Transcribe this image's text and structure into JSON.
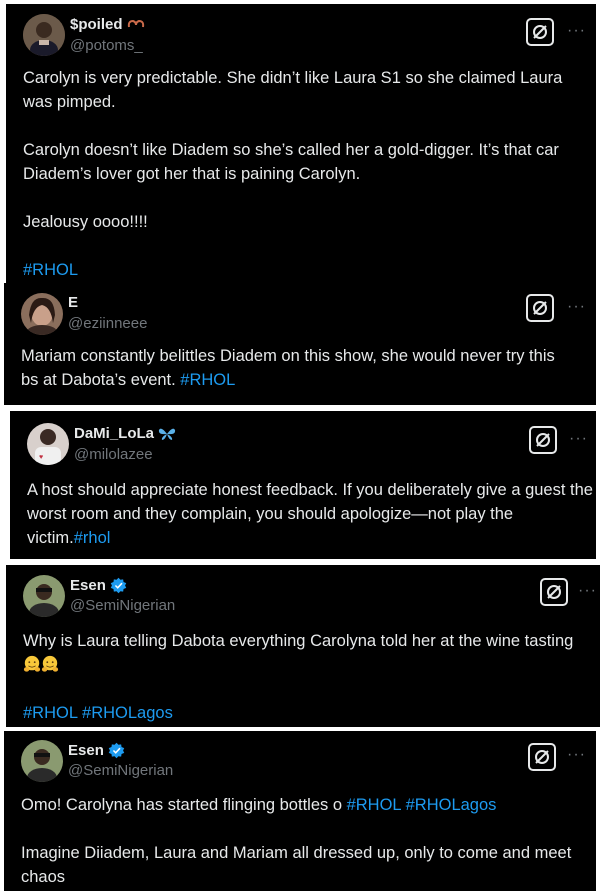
{
  "tweets": [
    {
      "name": "$poiled",
      "handle": "@potoms_",
      "text": {
        "p1": "Carolyn is very predictable. She didn’t like Laura S1 so she claimed Laura was pimped.",
        "p2": "Carolyn doesn’t like Diadem so she’s called her a gold-digger. It’s that car Diadem’s lover got her that is paining Carolyn.",
        "p3": "Jealousy oooo!!!!",
        "tag1": "#RHOL"
      }
    },
    {
      "name": "E",
      "handle": "@eziinneee",
      "text": {
        "p1": "Mariam constantly belittles Diadem on this show, she would never try this bs at Dabota’s event. ",
        "tag1": "#RHOL"
      }
    },
    {
      "name": "DaMi_LoLa",
      "handle": "@milolazee",
      "text": {
        "p1": "A host should appreciate honest feedback. If you deliberately give a guest the worst room and they complain, you should apologize—not play the victim.",
        "tag1": "#rhol"
      }
    },
    {
      "name": "Esen",
      "handle": "@SemiNigerian",
      "text": {
        "p1": "Why is Laura telling Dabota everything Carolyna told her at the wine tasting ",
        "tag1": "#RHOL",
        "tag2": "#RHOLagos"
      }
    },
    {
      "name": "Esen",
      "handle": "@SemiNigerian",
      "text": {
        "p1": "Omo! Carolyna has started flinging bottles o ",
        "tag1": "#RHOL",
        "tag2": "#RHOLagos",
        "p2": "Imagine Diiadem, Laura and Mariam all dressed up, only to come and meet chaos"
      }
    }
  ],
  "more_label": "···",
  "colors": {
    "card_bg": "#000000",
    "text": "#e7e9ea",
    "muted": "#71767b",
    "link": "#1d9bf0"
  }
}
